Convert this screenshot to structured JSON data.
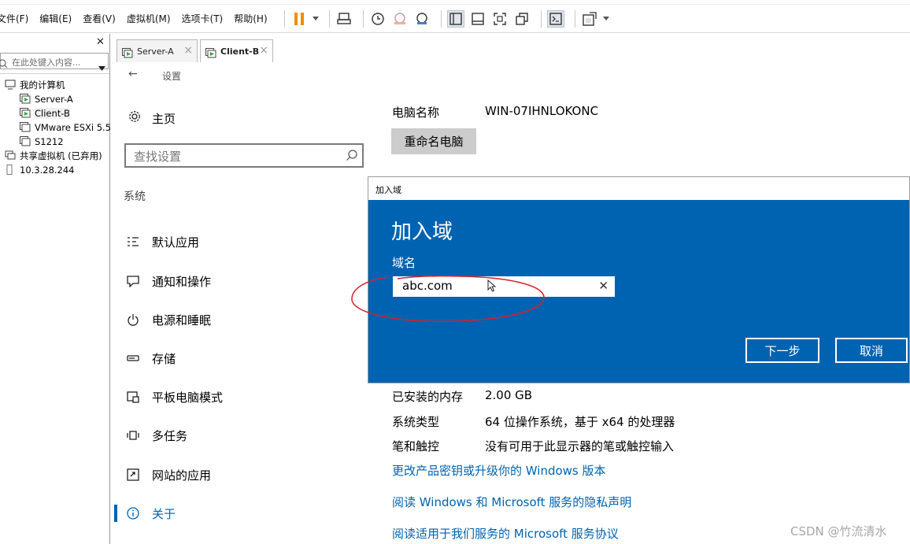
{
  "menubar": {
    "items": [
      "文件(F)",
      "编辑(E)",
      "查看(V)",
      "虚拟机(M)",
      "选项卡(T)",
      "帮助(H)"
    ]
  },
  "toolbar": {
    "icons": [
      "pause-icon",
      "send-ctrl-alt-del-icon",
      "snapshot-icon",
      "revert-snapshot-icon",
      "snapshot-manager-icon",
      "library-view-icon",
      "thumbnail-view-icon",
      "fullscreen-icon",
      "unity-icon",
      "console-icon",
      "stretch-icon"
    ]
  },
  "library": {
    "search_placeholder": "在此处键入内容...",
    "tree": {
      "root": "我的计算机",
      "vms": [
        "Server-A",
        "Client-B",
        "VMware ESXi 5.5",
        "S1212"
      ],
      "shared": "共享虚拟机 (已弃用)",
      "remote": "10.3.28.244"
    }
  },
  "tabs": [
    {
      "label": "Server-A",
      "active": false
    },
    {
      "label": "Client-B",
      "active": true
    }
  ],
  "settings": {
    "title": "设置",
    "home": "主页",
    "search_placeholder": "查找设置",
    "section": "系统",
    "nav": [
      {
        "label": "默认应用",
        "icon": "default-apps-icon"
      },
      {
        "label": "通知和操作",
        "icon": "notifications-icon"
      },
      {
        "label": "电源和睡眠",
        "icon": "power-icon"
      },
      {
        "label": "存储",
        "icon": "storage-icon"
      },
      {
        "label": "平板电脑模式",
        "icon": "tablet-mode-icon"
      },
      {
        "label": "多任务",
        "icon": "multitasking-icon"
      },
      {
        "label": "网站的应用",
        "icon": "apps-for-websites-icon"
      },
      {
        "label": "关于",
        "icon": "info-icon",
        "active": true
      }
    ]
  },
  "about": {
    "pc_name_label": "电脑名称",
    "pc_name_value": "WIN-07IHNLOKONC",
    "rename_button": "重命名电脑",
    "specs": [
      {
        "key": "已安装的内存",
        "value": "2.00 GB"
      },
      {
        "key": "系统类型",
        "value": "64 位操作系统，基于 x64 的处理器"
      },
      {
        "key": "笔和触控",
        "value": "没有可用于此显示器的笔或触控输入"
      }
    ],
    "links": [
      "更改产品密钥或升级你的 Windows 版本",
      "阅读 Windows 和 Microsoft 服务的隐私声明",
      "阅读适用于我们服务的 Microsoft 服务协议"
    ]
  },
  "dialog": {
    "window_title": "加入域",
    "heading": "加入域",
    "field_label": "域名",
    "field_value": "abc.com",
    "next_button": "下一步",
    "cancel_button": "取消"
  },
  "colors": {
    "accent": "#0063b1",
    "annotation": "#d9202a"
  },
  "watermark": "CSDN @竹流清水"
}
